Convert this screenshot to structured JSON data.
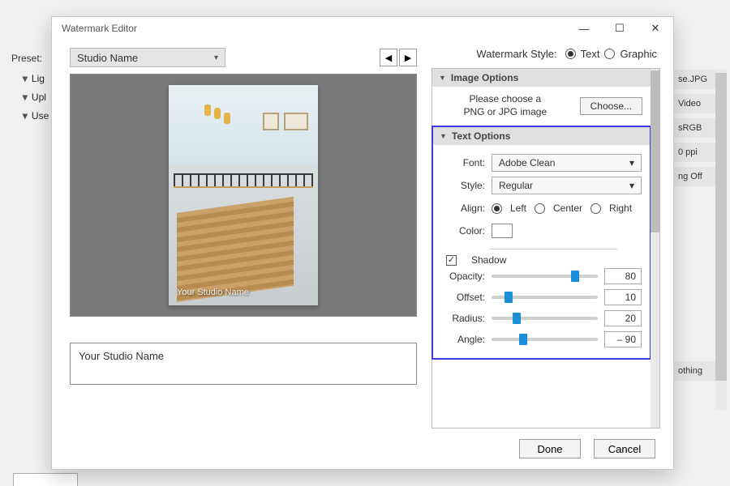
{
  "bg": {
    "preset_label": "Preset:",
    "tree": [
      "Lig",
      "Upl",
      "Use"
    ],
    "right_pills": [
      "se.JPG",
      "Video",
      "sRGB",
      "0 ppi",
      "ng Off"
    ],
    "bottom_pill": "othing"
  },
  "modal": {
    "title": "Watermark Editor",
    "preset_value": "Studio Name",
    "watermark_overlay": "Your Studio Name",
    "text_field": "Your Studio Name",
    "style": {
      "label": "Watermark Style:",
      "text_label": "Text",
      "graphic_label": "Graphic",
      "selected": "text"
    },
    "sections": {
      "image": {
        "header": "Image Options",
        "message_l1": "Please choose a",
        "message_l2": "PNG or JPG image",
        "choose_btn": "Choose..."
      },
      "text": {
        "header": "Text Options",
        "font_label": "Font:",
        "font_value": "Adobe Clean",
        "style_label": "Style:",
        "style_value": "Regular",
        "align_label": "Align:",
        "align_left": "Left",
        "align_center": "Center",
        "align_right": "Right",
        "color_label": "Color:"
      },
      "shadow": {
        "label": "Shadow",
        "opacity_label": "Opacity:",
        "opacity_value": "80",
        "offset_label": "Offset:",
        "offset_value": "10",
        "radius_label": "Radius:",
        "radius_value": "20",
        "angle_label": "Angle:",
        "angle_value": "– 90"
      }
    },
    "footer": {
      "done": "Done",
      "cancel": "Cancel"
    }
  }
}
